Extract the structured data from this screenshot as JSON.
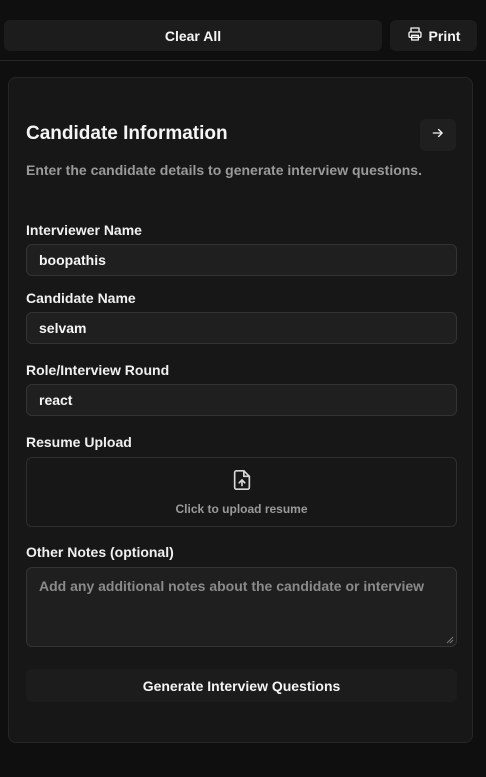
{
  "toolbar": {
    "clear_label": "Clear All",
    "print_label": "Print"
  },
  "card": {
    "title": "Candidate Information",
    "description": "Enter the candidate details to generate interview questions."
  },
  "form": {
    "interviewer": {
      "label": "Interviewer Name",
      "value": "boopathis"
    },
    "candidate": {
      "label": "Candidate Name",
      "value": "selvam"
    },
    "role": {
      "label": "Role/Interview Round",
      "value": "react"
    },
    "resume": {
      "label": "Resume Upload",
      "prompt": "Click to upload resume"
    },
    "notes": {
      "label": "Other Notes (optional)",
      "placeholder": "Add any additional notes about the candidate or interview"
    },
    "submit_label": "Generate Interview Questions"
  },
  "icons": {
    "print": "printer-icon",
    "next": "arrow-right-icon",
    "upload": "file-upload-icon"
  },
  "colors": {
    "background": "#0f0f0f",
    "card": "#171717",
    "input": "#1f1f1f",
    "text": "#f5f5f5",
    "muted": "#9a9a9a"
  }
}
